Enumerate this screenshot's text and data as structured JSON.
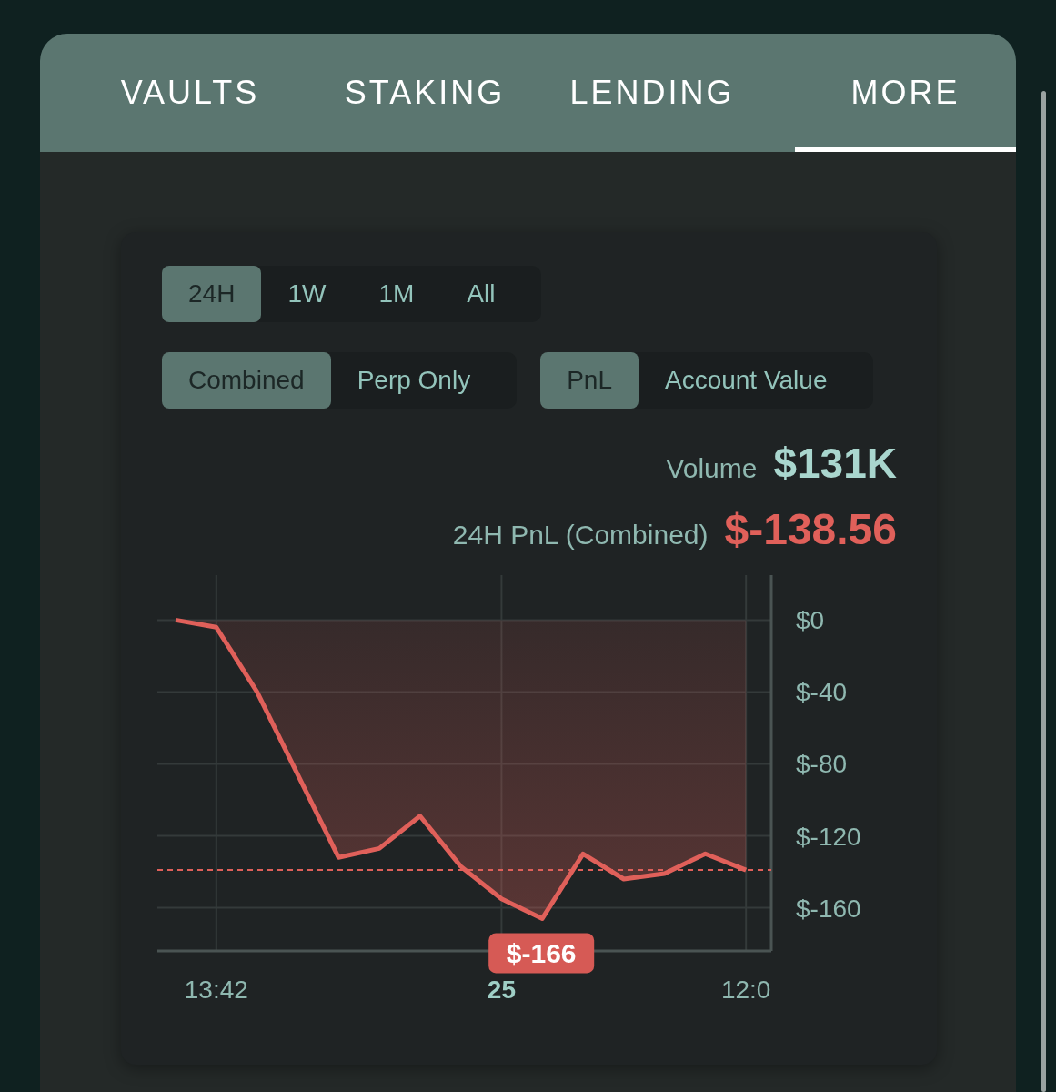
{
  "nav_tabs": [
    {
      "label": "VAULTS",
      "selected": false
    },
    {
      "label": "STAKING",
      "selected": false
    },
    {
      "label": "LENDING",
      "selected": false
    },
    {
      "label": "MORE",
      "selected": true
    }
  ],
  "periods": [
    {
      "label": "24H",
      "selected": true
    },
    {
      "label": "1W",
      "selected": false
    },
    {
      "label": "1M",
      "selected": false
    },
    {
      "label": "All",
      "selected": false
    }
  ],
  "scope": [
    {
      "label": "Combined",
      "selected": true
    },
    {
      "label": "Perp Only",
      "selected": false
    }
  ],
  "metric": [
    {
      "label": "PnL",
      "selected": true
    },
    {
      "label": "Account Value",
      "selected": false
    }
  ],
  "volume": {
    "label": "Volume",
    "value": "$131K"
  },
  "pnl": {
    "label": "24H PnL (Combined)",
    "value": "$-138.56"
  },
  "chart": {
    "chart_data": {
      "type": "area",
      "categories": [
        null,
        "13:42",
        null,
        null,
        null,
        null,
        null,
        null,
        "25",
        null,
        null,
        null,
        null,
        null,
        "12:0"
      ],
      "series": [
        {
          "color": "#e0605a",
          "values": [
            0,
            -4,
            -40,
            -86,
            -132,
            -127,
            -109,
            -137,
            -155,
            -166,
            -130,
            -144,
            -141,
            -130,
            -139
          ]
        }
      ],
      "ylim": [
        -184,
        25
      ],
      "yticks": [
        {
          "value": 0,
          "label": "$0"
        },
        {
          "value": -40,
          "label": "$-40"
        },
        {
          "value": -80,
          "label": "$-80"
        },
        {
          "value": -120,
          "label": "$-120"
        },
        {
          "value": -160,
          "label": "$-160"
        }
      ],
      "grid": true,
      "ref_lines": [
        {
          "axis": "y",
          "value": -139
        }
      ],
      "annotations": [
        {
          "y": -166,
          "text": "$-166"
        }
      ]
    }
  }
}
